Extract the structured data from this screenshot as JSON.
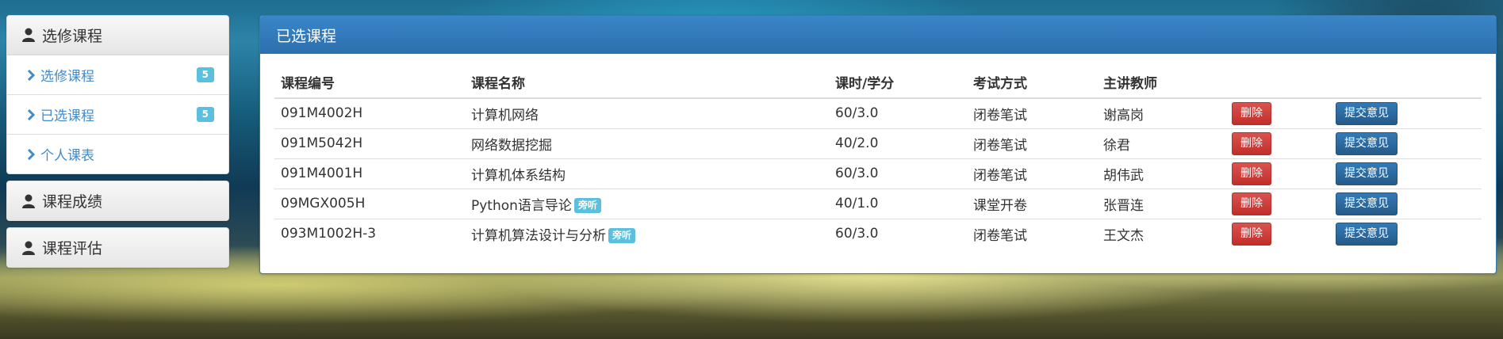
{
  "sidebar": {
    "panels": [
      {
        "title": "选修课程",
        "items": [
          {
            "label": "选修课程",
            "badge": "5"
          },
          {
            "label": "已选课程",
            "badge": "5"
          },
          {
            "label": "个人课表"
          }
        ]
      },
      {
        "title": "课程成绩"
      },
      {
        "title": "课程评估"
      }
    ]
  },
  "main": {
    "title": "已选课程",
    "columns": [
      "课程编号",
      "课程名称",
      "课时/学分",
      "考试方式",
      "主讲教师",
      "",
      ""
    ],
    "rows": [
      {
        "code": "091M4002H",
        "name": "计算机网络",
        "tag": "",
        "hours": "60/3.0",
        "exam": "闭卷笔试",
        "teacher": "谢高岗",
        "delete": "删除",
        "feedback": "提交意见"
      },
      {
        "code": "091M5042H",
        "name": "网络数据挖掘",
        "tag": "",
        "hours": "40/2.0",
        "exam": "闭卷笔试",
        "teacher": "徐君",
        "delete": "删除",
        "feedback": "提交意见"
      },
      {
        "code": "091M4001H",
        "name": "计算机体系结构",
        "tag": "",
        "hours": "60/3.0",
        "exam": "闭卷笔试",
        "teacher": "胡伟武",
        "delete": "删除",
        "feedback": "提交意见"
      },
      {
        "code": "09MGX005H",
        "name": "Python语言导论",
        "tag": "旁听",
        "hours": "40/1.0",
        "exam": "课堂开卷",
        "teacher": "张晋连",
        "delete": "删除",
        "feedback": "提交意见"
      },
      {
        "code": "093M1002H-3",
        "name": "计算机算法设计与分析",
        "tag": "旁听",
        "hours": "60/3.0",
        "exam": "闭卷笔试",
        "teacher": "王文杰",
        "delete": "删除",
        "feedback": "提交意见"
      }
    ]
  },
  "colors": {
    "primary": "#337ab7",
    "danger": "#d9534f",
    "info": "#5bc0de",
    "link": "#428bca"
  }
}
